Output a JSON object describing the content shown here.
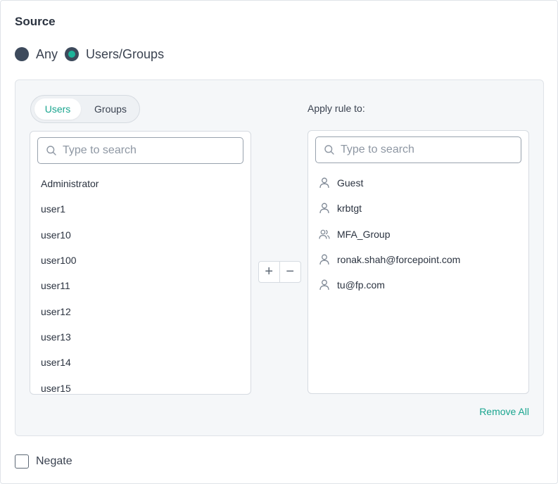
{
  "section": {
    "title": "Source"
  },
  "source_radios": [
    {
      "label": "Any",
      "checked": false
    },
    {
      "label": "Users/Groups",
      "checked": true
    }
  ],
  "tabs": {
    "users": "Users",
    "groups": "Groups",
    "active": "Users"
  },
  "available": {
    "search_placeholder": "Type to search",
    "items": [
      "Administrator",
      "user1",
      "user10",
      "user100",
      "user11",
      "user12",
      "user13",
      "user14",
      "user15"
    ]
  },
  "apply": {
    "label": "Apply rule to:",
    "search_placeholder": "Type to search",
    "items": [
      {
        "label": "Guest",
        "icon": "user-icon"
      },
      {
        "label": "krbtgt",
        "icon": "user-icon"
      },
      {
        "label": "MFA_Group",
        "icon": "group-icon"
      },
      {
        "label": "ronak.shah@forcepoint.com",
        "icon": "user-icon"
      },
      {
        "label": "tu@fp.com",
        "icon": "user-icon"
      }
    ]
  },
  "move": {
    "add": "+",
    "remove": "−"
  },
  "remove_all": "Remove All",
  "negate": {
    "label": "Negate",
    "checked": false
  },
  "colors": {
    "accent": "#1aa58f",
    "radio_fill": "#3d4a5c",
    "text": "#2b3340"
  }
}
